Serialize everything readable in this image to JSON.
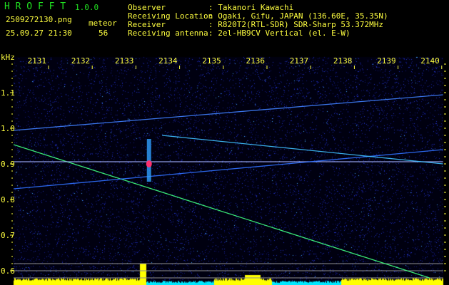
{
  "header": {
    "app_name": "H R O F F T",
    "version": "1.0.0",
    "filename": "2509272130.png",
    "datetime": "25.09.27 21:30",
    "count_label": "meteor",
    "count": "56",
    "info": [
      {
        "label": "Observer",
        "value": ": Takanori Kawachi"
      },
      {
        "label": "Receiving Location",
        "value": ": Ogaki, Gifu, JAPAN (136.60E, 35.35N)"
      },
      {
        "label": "Receiver",
        "value": ": R820T2(RTL-SDR) SDR-Sharp 53.372MHz"
      },
      {
        "label": "Receiving antenna",
        "value": ": 2el-HB9CV Vertical (el. E-W)"
      }
    ]
  },
  "chart_data": {
    "type": "heatmap",
    "ylabel": "kHz",
    "xlim": [
      2130.2,
      2140.05
    ],
    "ylim": [
      0.56,
      1.2
    ],
    "x_ticks": [
      "2131",
      "2132",
      "2133",
      "2134",
      "2135",
      "2136",
      "2137",
      "2138",
      "2139",
      "2140"
    ],
    "y_ticks": [
      "1.1",
      "1.0",
      "0.9",
      "0.8",
      "0.7",
      "0.6"
    ],
    "colors": {
      "background": "#000000",
      "noise": "#1020a0",
      "text": "#ffff40",
      "title": "#20e020",
      "signal": "#ffff00",
      "signal_low": "#00e8ff"
    },
    "traces": [
      {
        "x": [
          2130.2,
          2139.72
        ],
        "y": [
          0.954,
          0.58
        ],
        "color": "#40ff80"
      },
      {
        "x": [
          2130.2,
          2140.03
        ],
        "y": [
          0.994,
          1.094
        ],
        "color": "#4080ff"
      },
      {
        "x": [
          2130.2,
          2140.03
        ],
        "y": [
          0.906,
          0.906
        ],
        "color": "#a0b0ff"
      },
      {
        "x": [
          2130.2,
          2140.03
        ],
        "y": [
          0.83,
          0.94
        ],
        "color": "#3070ff"
      },
      {
        "x": [
          2133.6,
          2140.03
        ],
        "y": [
          0.98,
          0.9
        ],
        "color": "#40c0ff"
      }
    ],
    "meteor": {
      "x": 2133.3,
      "y_range": [
        0.85,
        0.97
      ],
      "head": 0.9
    }
  }
}
